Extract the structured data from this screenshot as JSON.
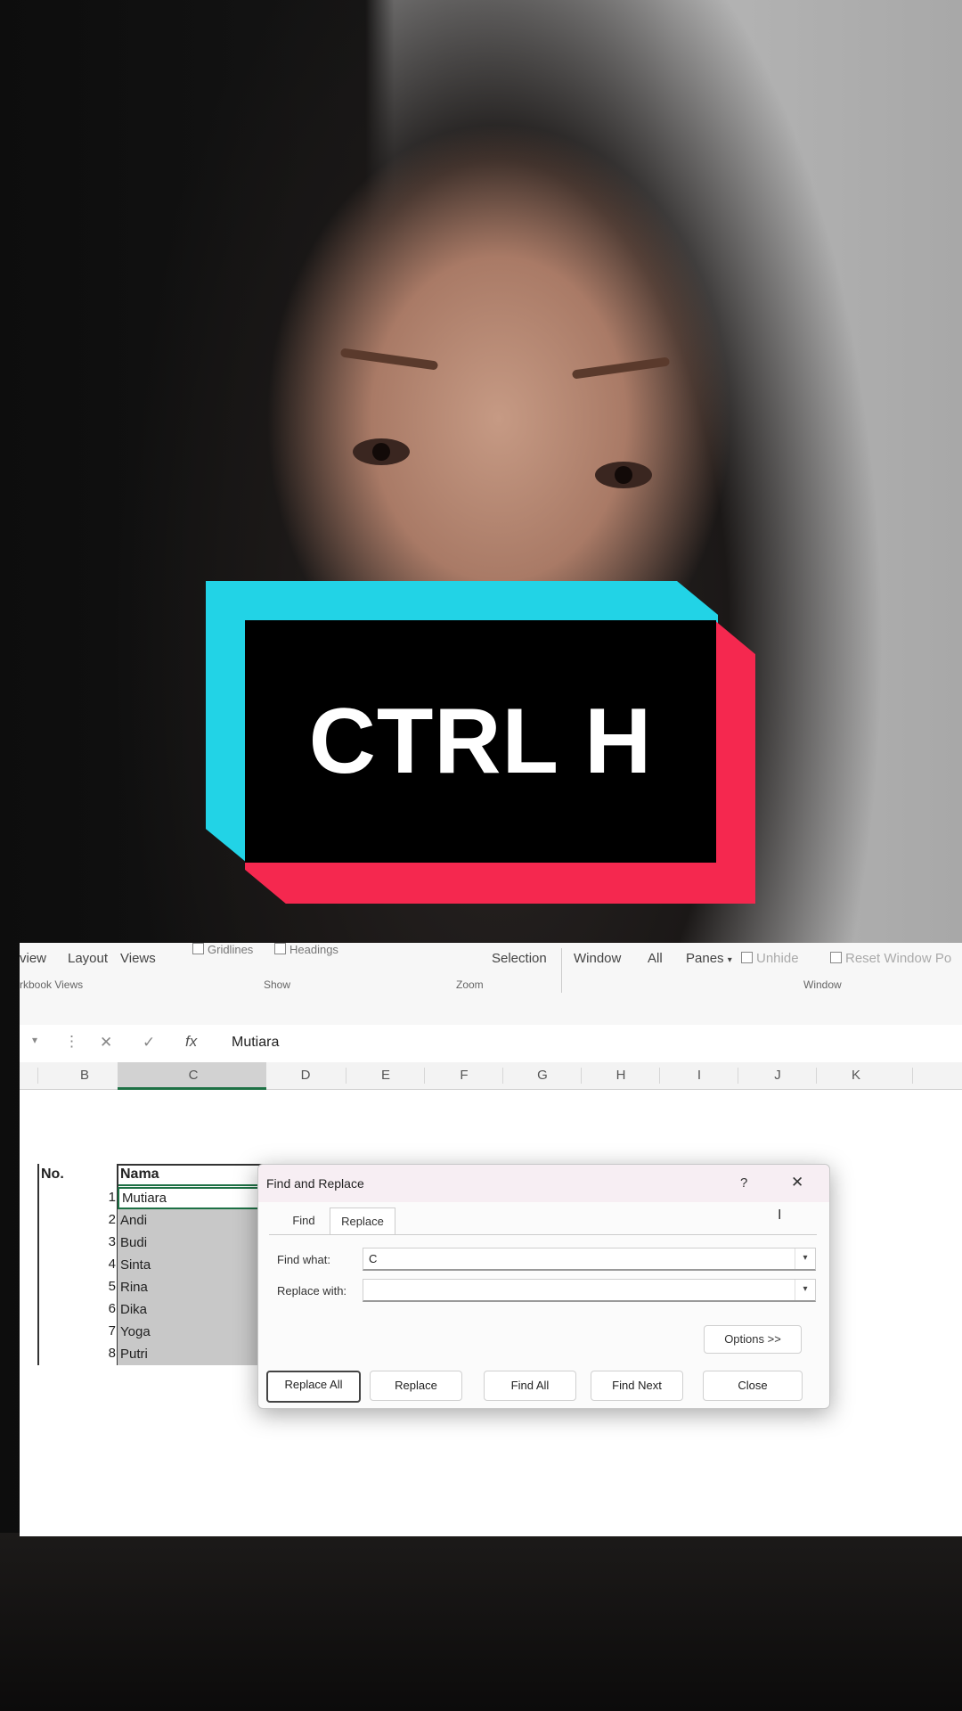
{
  "overlay": {
    "badge_text": "CTRL H"
  },
  "ribbon": {
    "tabs_partial": [
      "view",
      "Layout",
      "Views"
    ],
    "show_checks": [
      "Gridlines",
      "Headings"
    ],
    "selection_label": "Selection",
    "window_items": [
      "Window",
      "All",
      "Panes",
      "Unhide",
      "Reset Window Po"
    ],
    "group_labels": [
      "rkbook Views",
      "Show",
      "Zoom",
      "Window"
    ]
  },
  "formula_bar": {
    "cancel_glyph": "✕",
    "enter_glyph": "✓",
    "fx_glyph": "fx",
    "value": "Mutiara"
  },
  "columns": [
    "B",
    "C",
    "D",
    "E",
    "F",
    "G",
    "H",
    "I",
    "J",
    "K"
  ],
  "table": {
    "header_no": "No.",
    "header_nama": "Nama",
    "rows": [
      {
        "no": "1",
        "nama": "Mutiara"
      },
      {
        "no": "2",
        "nama": "Andi"
      },
      {
        "no": "3",
        "nama": "Budi"
      },
      {
        "no": "4",
        "nama": "Sinta"
      },
      {
        "no": "5",
        "nama": "Rina"
      },
      {
        "no": "6",
        "nama": "Dika"
      },
      {
        "no": "7",
        "nama": "Yoga"
      },
      {
        "no": "8",
        "nama": "Putri"
      }
    ]
  },
  "dialog": {
    "title": "Find and Replace",
    "help": "?",
    "close": "✕",
    "tabs": [
      "Find",
      "Replace"
    ],
    "find_label": "Find what:",
    "find_value": "C",
    "replace_label": "Replace with:",
    "replace_value": "",
    "options_button": "Options >>",
    "buttons": [
      "Replace All",
      "Replace",
      "Find All",
      "Find Next",
      "Close"
    ]
  }
}
